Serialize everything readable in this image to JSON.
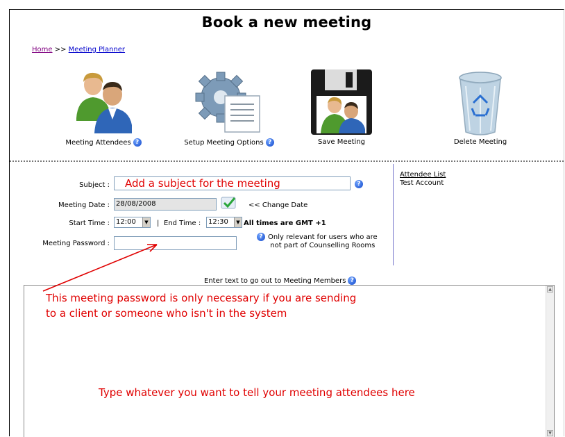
{
  "page": {
    "title": "Book a new meeting"
  },
  "breadcrumb": {
    "home": "Home",
    "separator": ">>",
    "current": "Meeting Planner"
  },
  "toolbar": {
    "attendees_label": "Meeting Attendees",
    "options_label": "Setup Meeting Options",
    "save_label": "Save Meeting",
    "delete_label": "Delete Meeting"
  },
  "form": {
    "subject_label": "Subject :",
    "subject_value": "Add a subject for the meeting",
    "date_label": "Meeting Date :",
    "date_value": "28/08/2008",
    "change_date_label": "<< Change Date",
    "start_label": "Start Time :",
    "start_value": "12:00",
    "end_separator": "|",
    "end_label": "End Time :",
    "end_value": "12:30",
    "gmt_note": "All times are GMT +1",
    "password_label": "Meeting Password :",
    "password_note_line1": "Only relevant for users who are",
    "password_note_line2": "not part of Counselling Rooms"
  },
  "attendees": {
    "heading": "Attendee List",
    "items": [
      "Test Account"
    ]
  },
  "message": {
    "label": "Enter text to go out to Meeting Members"
  },
  "annotations": {
    "password_line1": "This meeting password is only necessary if you are sending",
    "password_line2": "to a client or someone who isn't in the system",
    "body_hint": "Type whatever you want to tell your meeting attendees here"
  },
  "colors": {
    "annotation": "#e00000",
    "link": "#0000cc",
    "help_icon": "#1a4fd6"
  },
  "icons": {
    "help": "help-question-icon",
    "attendees": "people-icon",
    "options": "gear-document-icon",
    "save": "floppy-disk-icon",
    "delete": "recycle-bin-icon",
    "change_date": "checkmark-icon"
  }
}
